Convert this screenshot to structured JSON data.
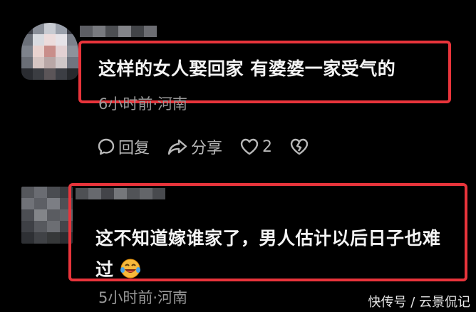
{
  "comments": [
    {
      "text": "这样的女人娶回家 有婆婆一家受气的",
      "meta": "6小时前·河南",
      "actions": {
        "reply_label": "回复",
        "share_label": "分享",
        "like_count": "2"
      }
    },
    {
      "text_line1": "这不知道嫁谁家了，男人估计以后日子也难",
      "text_line2": "过",
      "meta": "5小时前·河南"
    }
  ],
  "watermark": "快传号 / 云景侃记",
  "colors": {
    "background": "#000000",
    "highlight_box": "#e8343b",
    "meta_text": "#9a9a9a"
  },
  "icons": [
    "reply-icon",
    "share-icon",
    "heart-icon",
    "dislike-icon",
    "laughing-crying-emoji"
  ]
}
